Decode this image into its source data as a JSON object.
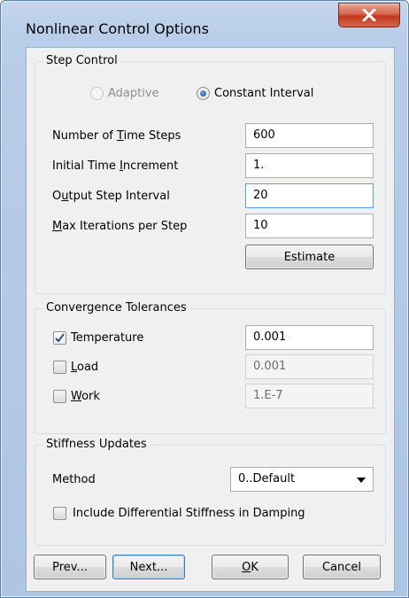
{
  "window": {
    "title": "Nonlinear Control Options",
    "close_glyph": "X"
  },
  "step_control": {
    "legend": "Step Control",
    "radio_adaptive": "Adaptive",
    "radio_constant": "Constant Interval",
    "selected_mode": "Constant Interval",
    "fields": [
      {
        "label_pre": "Number of ",
        "label_key": "T",
        "label_post": "ime Steps",
        "value": "600"
      },
      {
        "label_pre": "Initial Time ",
        "label_key": "I",
        "label_post": "ncrement",
        "value": "1."
      },
      {
        "label_pre": "O",
        "label_key": "u",
        "label_post": "tput Step Interval",
        "value": "20"
      },
      {
        "label_pre": "",
        "label_key": "M",
        "label_post": "ax Iterations per Step",
        "value": "10"
      }
    ],
    "estimate_label": "Estimate"
  },
  "convergence": {
    "legend": "Convergence Tolerances",
    "items": [
      {
        "label_key": "",
        "label_post": "Temperature",
        "checked": true,
        "value": "0.001"
      },
      {
        "label_key": "L",
        "label_post": "oad",
        "checked": false,
        "value": "0.001"
      },
      {
        "label_key": "W",
        "label_post": "ork",
        "checked": false,
        "value": "1.E-7"
      }
    ]
  },
  "stiffness": {
    "legend": "Stiffness Updates",
    "method_label": "Method",
    "method_value": "0..Default",
    "damping_label": "Include Differential Stiffness in Damping",
    "damping_checked": false
  },
  "buttons": {
    "prev": "Prev...",
    "next": "Next...",
    "ok_key": "O",
    "ok_post": "K",
    "cancel": "Cancel"
  },
  "colors": {
    "accent": "#3c7fb1",
    "checkmark": "#1e4f86",
    "close_bg": "#c2381f"
  }
}
